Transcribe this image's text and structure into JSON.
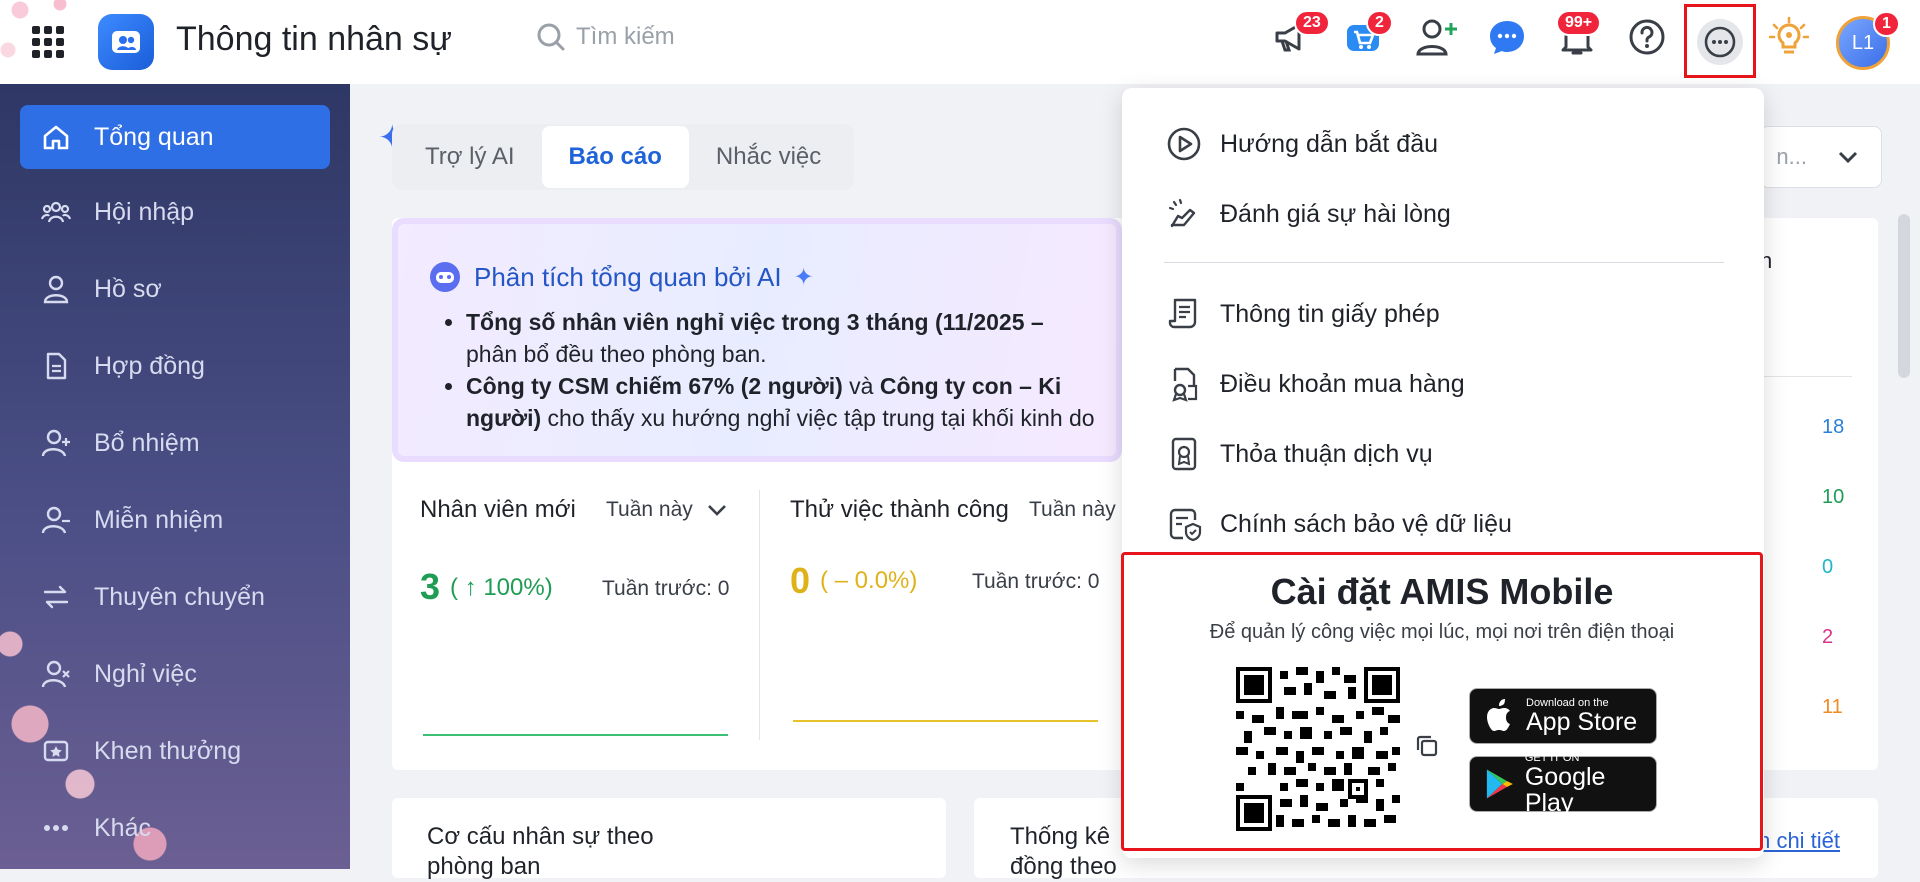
{
  "header": {
    "app_title": "Thông tin nhân sự",
    "search_placeholder": "Tìm kiếm",
    "icons": [
      {
        "name": "announcement-icon",
        "badge": "23"
      },
      {
        "name": "cart-icon",
        "badge": "2"
      },
      {
        "name": "add-user-icon",
        "badge": ""
      },
      {
        "name": "chat-icon",
        "badge": ""
      },
      {
        "name": "bell-icon",
        "badge": "99+"
      },
      {
        "name": "help-icon",
        "badge": ""
      },
      {
        "name": "more-icon",
        "badge": ""
      },
      {
        "name": "idea-icon",
        "badge": ""
      }
    ],
    "avatar_initials": "L1",
    "avatar_badge": "1"
  },
  "sidebar": {
    "items": [
      {
        "label": "Tổng quan",
        "icon": "home-icon",
        "active": true
      },
      {
        "label": "Hội nhập",
        "icon": "group-icon",
        "active": false
      },
      {
        "label": "Hồ sơ",
        "icon": "person-icon",
        "active": false
      },
      {
        "label": "Hợp đồng",
        "icon": "document-icon",
        "active": false
      },
      {
        "label": "Bổ nhiệm",
        "icon": "person-plus-icon",
        "active": false
      },
      {
        "label": "Miễn nhiệm",
        "icon": "person-minus-icon",
        "active": false
      },
      {
        "label": "Thuyên chuyển",
        "icon": "transfer-icon",
        "active": false
      },
      {
        "label": "Nghỉ việc",
        "icon": "person-x-icon",
        "active": false
      },
      {
        "label": "Khen thưởng",
        "icon": "award-icon",
        "active": false
      },
      {
        "label": "Khác",
        "icon": "dots-icon",
        "active": false
      }
    ]
  },
  "tabs": [
    {
      "label": "Trợ lý AI",
      "active": false
    },
    {
      "label": "Báo cáo",
      "active": true
    },
    {
      "label": "Nhắc việc",
      "active": false
    }
  ],
  "period_select": {
    "value": "n..."
  },
  "ai_analysis": {
    "title": "Phân tích tổng quan bởi AI",
    "bullet1_bold": "Tổng số nhân viên nghỉ việc trong 3 tháng (11/2025 –",
    "bullet1_rest": "phân bổ đều theo phòng ban.",
    "bullet2_bold_a": "Công ty CSM chiếm 67% (2 người)",
    "bullet2_mid": " và ",
    "bullet2_bold_b": "Công ty con – Ki",
    "bullet2_bold_c": "người)",
    "bullet2_rest": " cho thấy xu hướng nghỉ việc tập trung tại khối kinh do"
  },
  "stats": {
    "new_employees": {
      "title": "Nhân viên mới",
      "period": "Tuần này",
      "value": "3",
      "change": "( ↑ 100%)",
      "prev": "Tuần trước: 0"
    },
    "probation_success": {
      "title": "Thử việc thành công",
      "period": "Tuần này",
      "value": "0",
      "change": "( – 0.0%)",
      "prev": "Tuần trước: 0"
    }
  },
  "right_panel": {
    "label_fragment": "n",
    "values": [
      {
        "value": "18",
        "color": "#2a7fd8"
      },
      {
        "value": "10",
        "color": "#1f9d55"
      },
      {
        "value": "0",
        "color": "#1fb6c6"
      },
      {
        "value": "2",
        "color": "#d6338a"
      },
      {
        "value": "11",
        "color": "#f08a24"
      }
    ]
  },
  "bottom_cards": {
    "left_title_line1": "Cơ cấu nhân sự theo",
    "left_title_line2": "phòng ban",
    "right_title_line1": "Thống kê",
    "right_title_line2": "đồng theo",
    "detail_link": "m chi tiết"
  },
  "dropdown": {
    "items": [
      {
        "label": "Hướng dẫn bắt đầu",
        "icon": "play-circle-icon"
      },
      {
        "label": "Đánh giá sự hài lòng",
        "icon": "rating-hand-icon"
      },
      {
        "label": "Thông tin giấy phép",
        "icon": "license-scroll-icon"
      },
      {
        "label": "Điều khoản mua hàng",
        "icon": "purchase-terms-icon"
      },
      {
        "label": "Thỏa thuận dịch vụ",
        "icon": "service-agreement-icon"
      },
      {
        "label": "Chính sách bảo vệ dữ liệu",
        "icon": "data-protection-icon"
      }
    ],
    "mobile": {
      "title": "Cài đặt AMIS Mobile",
      "subtitle": "Để quản lý công việc mọi lúc, mọi nơi trên điện thoại",
      "app_store_small": "Download on the",
      "app_store_big": "App Store",
      "google_play_small": "GET IT ON",
      "google_play_big": "Google Play"
    }
  }
}
